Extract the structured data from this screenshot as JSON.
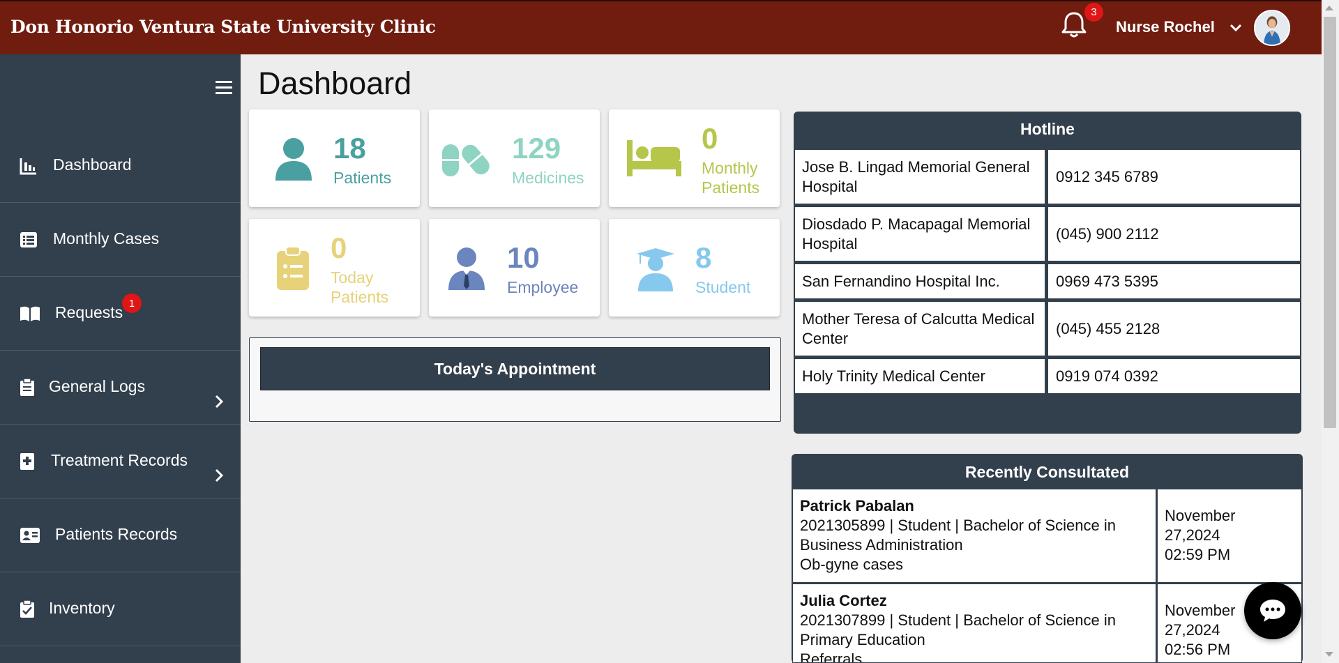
{
  "header": {
    "brand": "Don Honorio Ventura State University Clinic",
    "notification_count": "3",
    "user_name": "Nurse Rochel"
  },
  "sidebar": {
    "items": [
      {
        "label": "Dashboard",
        "icon": "chart-icon"
      },
      {
        "label": "Monthly Cases",
        "icon": "list-icon"
      },
      {
        "label": "Requests",
        "icon": "book-icon",
        "badge": "1"
      },
      {
        "label": "General Logs",
        "icon": "clipboard-icon"
      },
      {
        "label": "Treatment Records",
        "icon": "medical-file-icon"
      },
      {
        "label": "Patients Records",
        "icon": "id-card-icon"
      },
      {
        "label": "Inventory",
        "icon": "clipboard-check-icon"
      }
    ]
  },
  "main": {
    "title": "Dashboard",
    "cards": [
      {
        "value": "18",
        "label": "Patients",
        "color": "#4a9fa0"
      },
      {
        "value": "129",
        "label": "Medicines",
        "color": "#8fd3c2"
      },
      {
        "value": "0",
        "label": "Monthly Patients",
        "color": "#b6c64a"
      },
      {
        "value": "0",
        "label": "Today Patients",
        "color": "#e7d27a"
      },
      {
        "value": "10",
        "label": "Employee",
        "color": "#6b85be"
      },
      {
        "value": "8",
        "label": "Student",
        "color": "#86c8ee"
      }
    ],
    "appointment_title": "Today's Appointment"
  },
  "hotline": {
    "title": "Hotline",
    "rows": [
      {
        "name": "Jose B. Lingad Memorial General Hospital",
        "number": "0912 345 6789"
      },
      {
        "name": "Diosdado P. Macapagal Memorial Hospital",
        "number": "(045) 900 2112"
      },
      {
        "name": "San Fernandino Hospital Inc.",
        "number": "0969 473 5395"
      },
      {
        "name": "Mother Teresa of Calcutta Medical Center",
        "number": "(045) 455 2128"
      },
      {
        "name": "Holy Trinity Medical Center",
        "number": "0919 074 0392"
      }
    ]
  },
  "recent": {
    "title": "Recently Consultated",
    "rows": [
      {
        "name": "Patrick Pabalan",
        "details": "2021305899 | Student | Bachelor of Science in Business Administration",
        "case": "Ob-gyne cases",
        "date": "November 27,2024",
        "time": "02:59 PM"
      },
      {
        "name": "Julia Cortez",
        "details": "2021307899 | Student | Bachelor of Science in Primary Education",
        "case": "Referrals",
        "date": "November 27,2024",
        "time": "02:56 PM"
      }
    ]
  }
}
